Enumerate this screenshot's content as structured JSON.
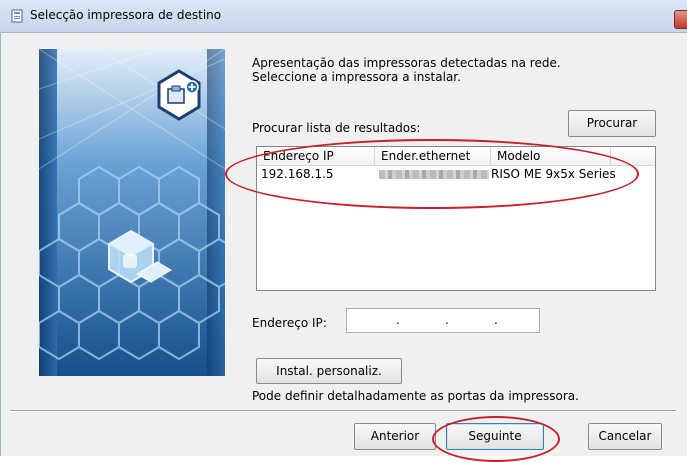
{
  "window": {
    "title": "Selecção impressora de destino"
  },
  "description": {
    "line1": "Apresentação das impressoras detectadas na rede.",
    "line2": "Seleccione a impressora a instalar."
  },
  "search": {
    "label": "Procurar lista de resultados:",
    "button_label": "Procurar"
  },
  "results": {
    "columns": [
      "Endereço IP",
      "Ender.ethernet",
      "Modelo"
    ],
    "rows": [
      {
        "ip": "192.168.1.5",
        "model": "RISO ME 9x5x Series"
      }
    ]
  },
  "ip_field": {
    "label": "Endereço IP:",
    "dot1": ".",
    "dot2": ".",
    "dot3": "."
  },
  "custom_install": {
    "button_label": "Instal. personaliz.",
    "description": "Pode definir detalhadamente as portas da impressora."
  },
  "footer": {
    "previous_label": "Anterior",
    "next_label": "Seguinte",
    "cancel_label": "Cancelar"
  },
  "colors": {
    "highlight_circle": "#c8202a",
    "art_background": "#1e5c9c"
  },
  "icons": {
    "title": "printer-setup-icon",
    "close": "close-icon",
    "art": "network-printer-cubes-graphic"
  }
}
